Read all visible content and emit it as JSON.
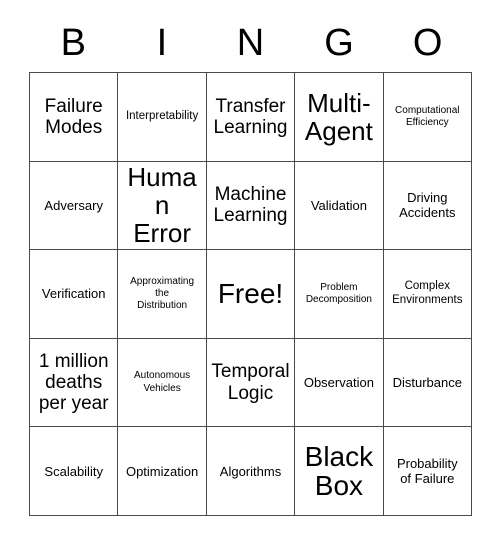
{
  "card": {
    "header_letters": [
      "B",
      "I",
      "N",
      "G",
      "O"
    ],
    "free_space_label": "Free!",
    "rows": [
      [
        {
          "text": "Failure\nModes",
          "size": "lg"
        },
        {
          "text": "Interpretability",
          "size": "sm"
        },
        {
          "text": "Transfer\nLearning",
          "size": "lg"
        },
        {
          "text": "Multi-\nAgent",
          "size": "xxl"
        },
        {
          "text": "Computational\nEfficiency",
          "size": "xs"
        }
      ],
      [
        {
          "text": "Adversary",
          "size": "md"
        },
        {
          "text": "Human\nError",
          "size": "xxl"
        },
        {
          "text": "Machine\nLearning",
          "size": "lg"
        },
        {
          "text": "Validation",
          "size": "md"
        },
        {
          "text": "Driving\nAccidents",
          "size": "md"
        }
      ],
      [
        {
          "text": "Verification",
          "size": "md"
        },
        {
          "text": "Approximating\nthe\nDistribution",
          "size": "xs"
        },
        {
          "text": "Free!",
          "size": "free"
        },
        {
          "text": "Problem\nDecomposition",
          "size": "xs"
        },
        {
          "text": "Complex\nEnvironments",
          "size": "sm"
        }
      ],
      [
        {
          "text": "1 million\ndeaths\nper year",
          "size": "lg"
        },
        {
          "text": "Autonomous\nVehicles",
          "size": "xs"
        },
        {
          "text": "Temporal\nLogic",
          "size": "lg"
        },
        {
          "text": "Observation",
          "size": "md"
        },
        {
          "text": "Disturbance",
          "size": "md"
        }
      ],
      [
        {
          "text": "Scalability",
          "size": "md"
        },
        {
          "text": "Optimization",
          "size": "md"
        },
        {
          "text": "Algorithms",
          "size": "md"
        },
        {
          "text": "Black\nBox",
          "size": "free"
        },
        {
          "text": "Probability\nof Failure",
          "size": "md"
        }
      ]
    ]
  },
  "colors": {
    "background": "#ffffff",
    "text": "#000000",
    "border": "#4a4a4a"
  }
}
